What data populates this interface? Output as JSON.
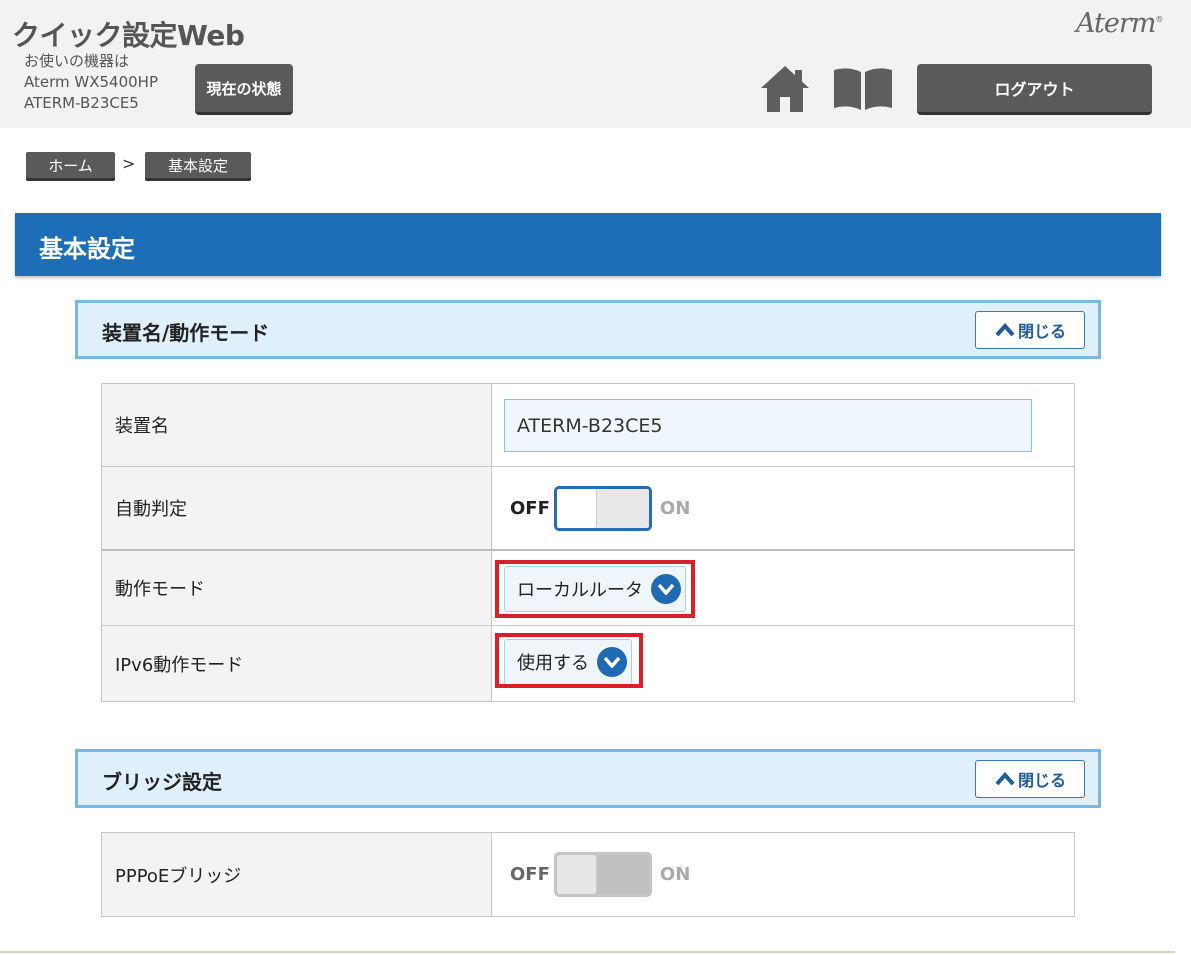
{
  "header": {
    "app_title": "クイック設定Web",
    "device_line1": "お使いの機器は",
    "device_line2": "Aterm WX5400HP",
    "device_line3": "ATERM-B23CE5",
    "status_button": "現在の状態",
    "logout_button": "ログアウト",
    "brand": "Aterm",
    "home_icon": "home-icon",
    "manual_icon": "book-icon"
  },
  "breadcrumb": {
    "home": "ホーム",
    "separator": ">",
    "current": "基本設定"
  },
  "page": {
    "title": "基本設定"
  },
  "sections": {
    "device_mode": {
      "title": "装置名/動作モード",
      "close_label": "閉じる",
      "rows": {
        "device_name": {
          "label": "装置名",
          "value": "ATERM-B23CE5"
        },
        "auto_detect": {
          "label": "自動判定",
          "off": "OFF",
          "on": "ON",
          "state": "OFF"
        },
        "operation_mode": {
          "label": "動作モード",
          "selected": "ローカルルータ"
        },
        "ipv6_mode": {
          "label": "IPv6動作モード",
          "selected": "使用する"
        }
      }
    },
    "bridge": {
      "title": "ブリッジ設定",
      "close_label": "閉じる",
      "rows": {
        "pppoe_bridge": {
          "label": "PPPoEブリッジ",
          "off": "OFF",
          "on": "ON",
          "state": "OFF",
          "enabled": false
        }
      }
    }
  },
  "colors": {
    "title_bar": "#1c6fb6",
    "section_border": "#7ab8e2",
    "highlight_box": "#d9202a",
    "dark_button": "#5a5a5a"
  }
}
